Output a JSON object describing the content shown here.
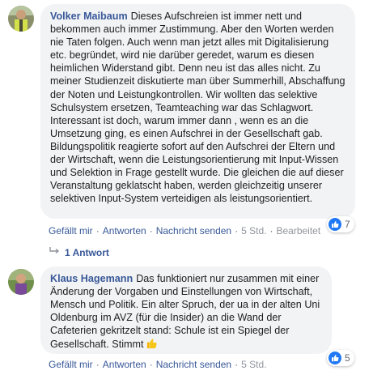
{
  "comments": [
    {
      "author": "Volker Maibaum",
      "text": "Dieses Aufschreien ist immer nett und bekommen auch immer Zustimmung. Aber den Worten werden nie Taten folgen. Auch wenn man jetzt alles mit Digitalisierung etc. begründet, wird nie darüber geredet, warum es diesen heimlichen Widerstand gibt. Denn neu ist das alles nicht. Zu meiner Studienzeit diskutierte man über Summerhill, Abschaffung der Noten und Leistungkontrollen. Wir wollten das selektive Schulsystem ersetzen, Teamteaching war das Schlagwort. Interessant ist doch, warum immer dann , wenn es an die Umsetzung ging, es einen Aufschrei in der Gesellschaft gab. Bildungspolitik reagierte sofort auf den Aufschrei der Eltern und der Wirtschaft, wenn die Leistungsorientierung mit Input-Wissen und Selektion in Frage gestellt wurde. Die gleichen die auf dieser Veranstaltung geklatscht haben, werden gleichzeitig unserer selektiven Input-System verteidigen als leistungsorientiert.",
      "reaction_count": "7",
      "actions": {
        "like": "Gefällt mir",
        "reply": "Antworten",
        "message": "Nachricht senden",
        "time": "5 Std.",
        "edited": "Bearbeitet"
      },
      "replies_label": "1 Antwort"
    },
    {
      "author": "Klaus Hagemann",
      "text": "Das funktioniert nur zusammen mit einer Änderung der Vorgaben und Einstellungen von Wirtschaft, Mensch und Politik. Ein alter Spruch, der ua in der alten Uni Oldenburg im AVZ (für die Insider) an die Wand der Cafeterien gekritzelt stand: Schule ist ein Spiegel der Gesellschaft. Stimmt",
      "reaction_count": "5",
      "actions": {
        "like": "Gefällt mir",
        "reply": "Antworten",
        "message": "Nachricht senden",
        "time": "5 Std."
      }
    }
  ],
  "colors": {
    "bubble_bg": "#f2f3f5",
    "author": "#385898",
    "link": "#385898",
    "meta": "#90949c",
    "like_blue": "#2078f4"
  },
  "icons": {
    "like_reaction": "thumbs-up-icon",
    "reply_arrow": "reply-arrow-icon",
    "emoji": "thumbs-up-emoji-icon"
  }
}
